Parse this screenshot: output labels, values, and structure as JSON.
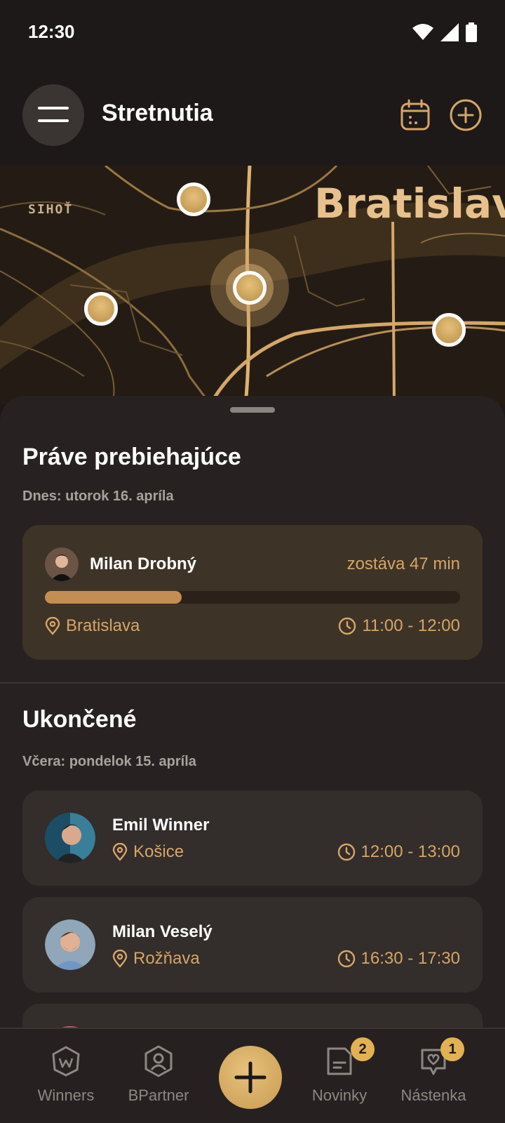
{
  "status_bar": {
    "time": "12:30"
  },
  "header": {
    "title": "Stretnutia"
  },
  "map": {
    "labels": {
      "district": "SIHOŤ",
      "city": "Bratislava"
    }
  },
  "ongoing": {
    "title": "Práve prebiehajúce",
    "date_label": "Dnes: utorok 16. apríla",
    "meeting": {
      "name": "Milan Drobný",
      "remaining": "zostáva 47 min",
      "location": "Bratislava",
      "time": "11:00 - 12:00",
      "progress": 0.33
    }
  },
  "finished": {
    "title": "Ukončené",
    "date_label": "Včera: pondelok 15. apríla",
    "meetings": [
      {
        "name": "Emil Winner",
        "location": "Košice",
        "time": "12:00 - 13:00"
      },
      {
        "name": "Milan Veselý",
        "location": "Rožňava",
        "time": "16:30 - 17:30"
      }
    ]
  },
  "bottom_nav": {
    "items": [
      {
        "label": "Winners",
        "icon": "winners-w-icon"
      },
      {
        "label": "BPartner",
        "icon": "user-shield-icon"
      },
      {
        "label": "Novinky",
        "icon": "news-icon",
        "badge": "2"
      },
      {
        "label": "Nástenka",
        "icon": "heart-message-icon",
        "badge": "1"
      }
    ],
    "fab_icon": "plus-icon"
  },
  "colors": {
    "accent": "#d6a567",
    "background": "#1c1918",
    "sheet": "#272221",
    "card": "#332d2b"
  }
}
